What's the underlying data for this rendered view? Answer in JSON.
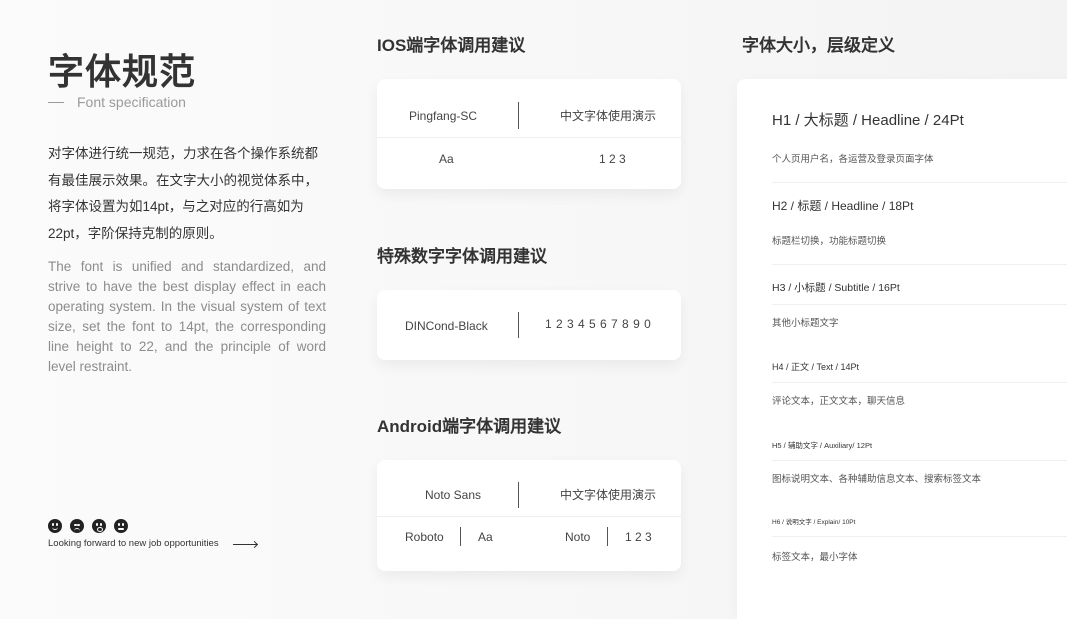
{
  "left": {
    "title": "字体规范",
    "subtitle": "Font specification",
    "desc_cn": [
      "对字体进行统一规范，力求在各个操作系统都",
      "有最佳展示效果。在文字大小的视觉体系中，",
      "将字体设置为如14pt，与之对应的行高如为",
      "22pt，字阶保持克制的原则。"
    ],
    "desc_en": "The font is unified and standardized, and strive to have the best display effect in each operating system. In the visual system of text size, set the font to 14pt, the corresponding line height to 22, and the principle of word level restraint.",
    "tagline": "Looking forward to new job opportunities",
    "faces": [
      "smile-face-icon",
      "dizzy-face-icon",
      "surprised-face-icon",
      "neutral-face-icon"
    ]
  },
  "ios": {
    "heading": "IOS端字体调用建议",
    "font": "Pingfang-SC",
    "demo_label": "中文字体使用演示",
    "sample": "Aa",
    "numbers": "1 2 3"
  },
  "special": {
    "heading": "特殊数字字体调用建议",
    "font": "DINCond-Black",
    "digits": "1 2 3 4 5 6 7 8 9 0"
  },
  "android": {
    "heading": "Android端字体调用建议",
    "font": "Noto Sans",
    "demo_label": "中文字体使用演示",
    "roboto": "Roboto",
    "sample": "Aa",
    "noto": "Noto",
    "numbers": "1 2 3"
  },
  "levels": {
    "heading": "字体大小，层级定义",
    "items": [
      {
        "label": "H1 / 大标题 / Headline / 24Pt",
        "desc": "个人页用户名，各运营及登录页面字体"
      },
      {
        "label": "H2 / 标题 / Headline / 18Pt",
        "desc": "标题栏切换，功能标题切换"
      },
      {
        "label": "H3 / 小标题 / Subtitle / 16Pt",
        "desc": "其他小标题文字"
      },
      {
        "label": "H4 / 正文 / Text / 14Pt",
        "desc": "评论文本，正文文本，聊天信息"
      },
      {
        "label": "H5 / 辅助文字 / Auxiliary/ 12Pt",
        "desc": "图标说明文本、各种辅助信息文本、搜索标签文本"
      },
      {
        "label": "H6 / 说明文字 / Explain/ 10Pt",
        "desc": "标签文本，最小字体"
      }
    ]
  }
}
